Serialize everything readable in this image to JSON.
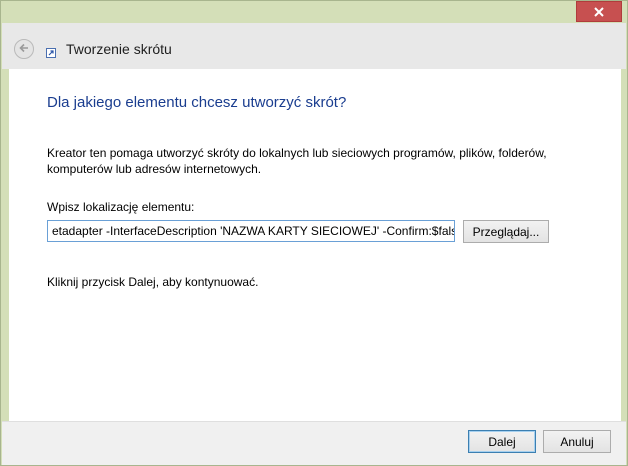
{
  "window": {
    "title": "Tworzenie skrótu",
    "close_icon": "close-icon",
    "back_icon": "back-arrow-icon",
    "app_icon": "shortcut-icon"
  },
  "main": {
    "heading": "Dla jakiego elementu chcesz utworzyć skrót?",
    "description": "Kreator ten pomaga utworzyć skróty do lokalnych lub sieciowych programów, plików, folderów, komputerów lub adresów internetowych.",
    "location_label": "Wpisz lokalizację elementu:",
    "location_value": "Disable-Netadapter -InterfaceDescription 'NAZWA KARTY SIECIOWEJ' -Confirm:$false",
    "location_visible": "etadapter -InterfaceDescription 'NAZWA KARTY SIECIOWEJ' -Confirm:$false",
    "browse_label": "Przeglądaj...",
    "hint": "Kliknij przycisk Dalej, aby kontynuować."
  },
  "footer": {
    "next_label": "Dalej",
    "cancel_label": "Anuluj"
  },
  "colors": {
    "frame": "#d4dfb8",
    "heading": "#1a3d8f",
    "close": "#c75050",
    "input_border": "#6aa0d6"
  }
}
